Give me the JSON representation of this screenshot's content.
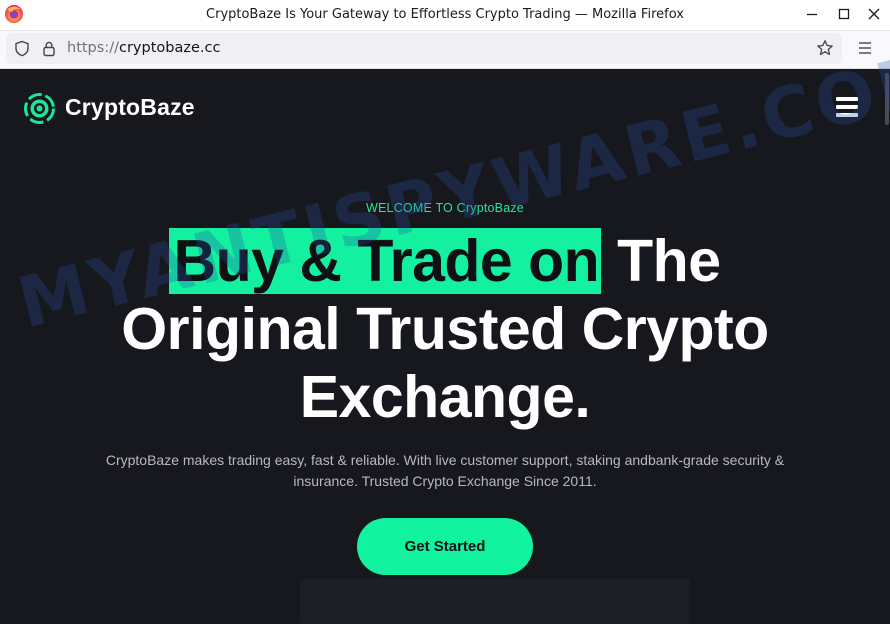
{
  "window": {
    "title": "CryptoBaze Is Your Gateway to Effortless Crypto Trading — Mozilla Firefox"
  },
  "addressbar": {
    "protocol": "https://",
    "domain": "cryptobaze.cc"
  },
  "site": {
    "brand_name": "CryptoBaze",
    "welcome": "WELCOME TO CryptoBaze",
    "headline_highlight": "Buy & Trade on",
    "headline_rest_line1": " The",
    "headline_line2": "Original Trusted Crypto",
    "headline_line3": "Exchange.",
    "subtitle": "CryptoBaze makes trading easy, fast & reliable. With live customer support, staking andbank-grade security & insurance. Trusted Crypto Exchange Since 2011.",
    "cta_label": "Get Started"
  },
  "watermark": "MYANTISPYWARE.COM",
  "colors": {
    "accent": "#12f39f",
    "page_bg": "#17181d"
  }
}
